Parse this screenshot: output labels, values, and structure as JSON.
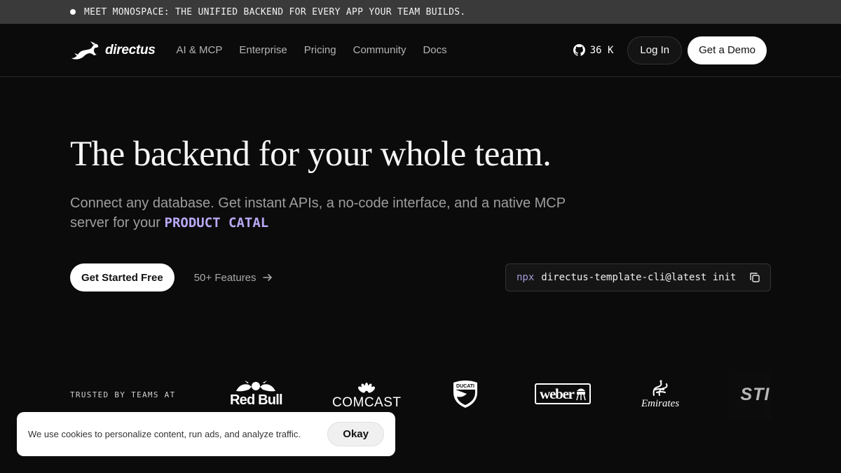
{
  "banner": {
    "text": "MEET MONOSPACE: THE UNIFIED BACKEND FOR EVERY APP YOUR TEAM BUILDS."
  },
  "nav": {
    "logo_text": "directus",
    "links": [
      "AI & MCP",
      "Enterprise",
      "Pricing",
      "Community",
      "Docs"
    ],
    "github_stars": "36 K",
    "login_label": "Log In",
    "demo_label": "Get a Demo"
  },
  "hero": {
    "title": "The backend for your whole team.",
    "subtitle": "Connect any database. Get instant APIs, a no-code interface, and a native MCP server for your",
    "highlight": "PRODUCT CATAL"
  },
  "cta": {
    "primary_label": "Get Started Free",
    "features_label": "50+ Features",
    "cli_prefix": "npx",
    "cli_command": "directus-template-cli@latest init"
  },
  "trusted": {
    "label": "TRUSTED BY TEAMS AT",
    "brands": [
      "Red Bull",
      "COMCAST",
      "Ducati",
      "weber",
      "Emirates",
      "STIHL"
    ],
    "brand_text": {
      "redbull": "Red Bull",
      "comcast": "COMCAST",
      "weber": "weber",
      "emirates": "Emirates",
      "stihl": "STI"
    }
  },
  "cookie": {
    "text": "We use cookies to personalize content, run ads, and analyze traffic.",
    "button_label": "Okay"
  },
  "colors": {
    "background": "#0b0b0b",
    "banner": "#3a3a3a",
    "accent_purple": "#b9a8f5",
    "nav_link": "#b4b4b4"
  },
  "icons": [
    "directus-rabbit-logo-icon",
    "github-icon",
    "arrow-right-icon",
    "copy-icon"
  ]
}
